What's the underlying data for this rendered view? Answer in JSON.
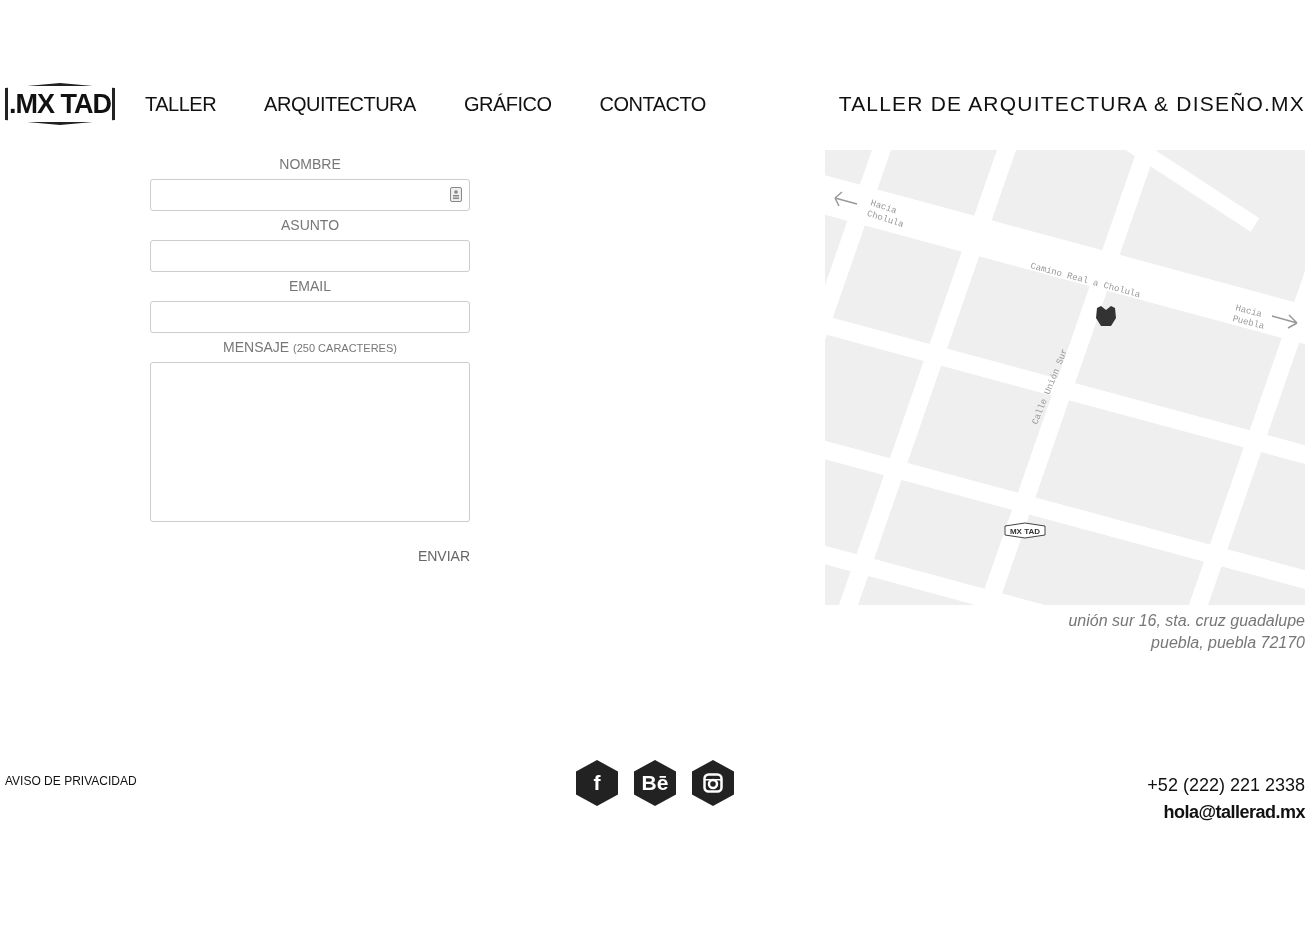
{
  "header": {
    "logo": ".MX TAD",
    "nav": [
      {
        "label": "TALLER",
        "selected": false
      },
      {
        "label": "ARQUITECTURA",
        "selected": false
      },
      {
        "label": "GRÁFICO",
        "selected": false
      },
      {
        "label": "CONTACTO",
        "selected": false
      }
    ],
    "tagline": "TALLER DE ARQUITECTURA & DISEÑO.MX"
  },
  "form": {
    "fields": [
      {
        "label": "NOMBRE",
        "kind": "input",
        "contact_icon": true
      },
      {
        "label": "ASUNTO",
        "kind": "input",
        "contact_icon": false
      },
      {
        "label": "EMAIL",
        "kind": "input",
        "contact_icon": false
      },
      {
        "label": "MENSAJE",
        "note": "(250 CARACTERES)",
        "kind": "textarea",
        "contact_icon": false
      }
    ],
    "submit": "ENVIAR"
  },
  "map": {
    "labels": [
      {
        "lines": [
          "Hacia",
          "Cholula"
        ],
        "kind": "left"
      },
      {
        "lines": [
          "Camino Real a Cholula"
        ],
        "kind": "road"
      },
      {
        "lines": [
          "Hacia",
          "Puebla"
        ],
        "kind": "right"
      },
      {
        "lines": [
          "Calle Unión Sur"
        ],
        "kind": "street"
      }
    ],
    "marker_logo": "MX TAD"
  },
  "address": [
    "unión sur 16, sta. cruz guadalupe",
    "puebla, puebla 72170"
  ],
  "footer": {
    "privacy": "AVISO DE PRIVACIDAD",
    "social": [
      {
        "kind": "facebook",
        "glyph": "f"
      },
      {
        "kind": "behance",
        "glyph": "Bē"
      },
      {
        "kind": "instagram"
      }
    ],
    "phone": "+52 (222) 221 2338",
    "email": "hola@tallerad.mx"
  }
}
